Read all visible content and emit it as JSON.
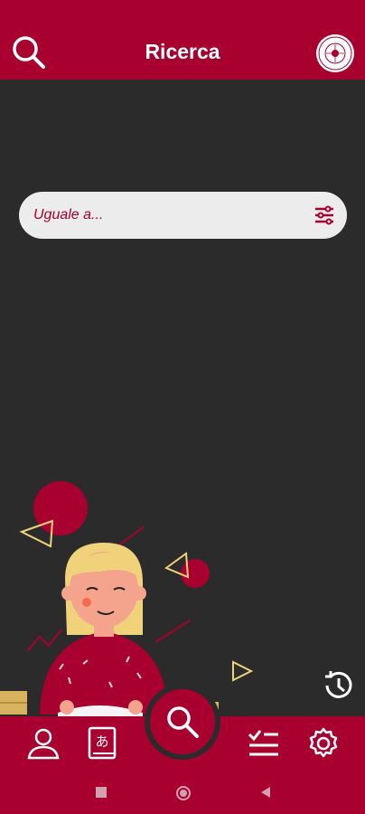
{
  "header": {
    "title": "Ricerca",
    "search_icon": "search-icon",
    "logo": "university-seal-logo"
  },
  "search": {
    "placeholder": "Uguale a...",
    "filter_icon": "sliders-icon"
  },
  "actions": {
    "history_icon": "history-icon"
  },
  "bottom_nav": {
    "items": [
      {
        "icon": "profile-icon"
      },
      {
        "icon": "dictionary-icon"
      },
      {
        "icon": "search-icon"
      },
      {
        "icon": "checklist-icon"
      },
      {
        "icon": "settings-icon"
      }
    ]
  },
  "colors": {
    "brand": "#a8002f",
    "background": "#2b2b2b",
    "searchbar": "#ececec",
    "accent_yellow": "#f0d27a"
  }
}
